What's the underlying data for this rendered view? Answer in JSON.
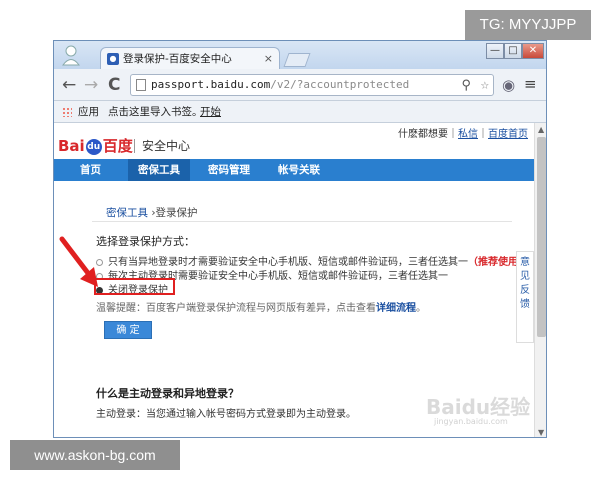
{
  "watermarks": {
    "tg": "TG: MYYJJPP",
    "site": "www.askon-bg.com"
  },
  "browser": {
    "tab_title": "登录保护-百度安全中心",
    "tab_close": "×",
    "controls": {
      "min": "—",
      "max": "□",
      "close": "✕"
    },
    "nav": {
      "back": "←",
      "forward": "→",
      "reload": "C"
    },
    "address": {
      "host": "passport.baidu.com",
      "path": "/v2/?accountprotected"
    },
    "icons": {
      "search": "⚲",
      "star": "☆",
      "globe": "◉",
      "menu": "≡"
    },
    "bookmarks": {
      "apps": "应用",
      "import": "点击这里导入书签。",
      "start": "开始"
    }
  },
  "page": {
    "logo": {
      "bai": "Bai",
      "du": "du",
      "cn": "百度"
    },
    "site_name": "安全中心",
    "top_links": {
      "prefix": "什麽都想要｜",
      "private": "私信",
      "sep": "｜",
      "home": "百度首页"
    },
    "nav_items": [
      "首页",
      "密保工具",
      "密码管理",
      "帐号关联"
    ],
    "breadcrumb": {
      "parent": "密保工具",
      "arrow": " ›",
      "current": "登录保护"
    },
    "section_label": "选择登录保护方式：",
    "options": [
      {
        "text": "只有当异地登录时才需要验证安全中心手机版、短信或邮件验证码，三者任选其一",
        "rec": "（推荐使用）"
      },
      {
        "text": "每次主动登录时需要验证安全中心手机版、短信或邮件验证码，三者任选其一"
      },
      {
        "text": "关闭登录保护"
      }
    ],
    "hint": {
      "text": "温馨提醒：百度客户端登录保护流程与网页版有差异，点击查看",
      "link": "详细流程",
      "end": "。"
    },
    "confirm_button": "确 定",
    "feedback": [
      "意",
      "见",
      "反",
      "馈"
    ],
    "faq_title": "什么是主动登录和异地登录？",
    "faq_text": "主动登录：当您通过输入帐号密码方式登录即为主动登录。",
    "baidu_watermark": "Baidu经验",
    "baidu_watermark_sub": "jingyan.baidu.com"
  }
}
